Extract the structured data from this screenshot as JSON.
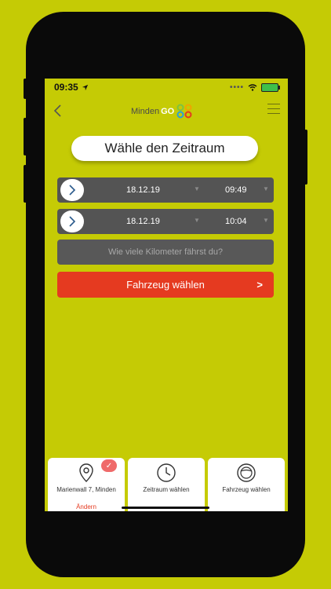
{
  "status": {
    "time": "09:35"
  },
  "header": {
    "logo_minden": "Minden",
    "logo_go": "GO"
  },
  "title": "Wähle den Zeitraum",
  "start": {
    "date": "18.12.19",
    "time": "09:49"
  },
  "end": {
    "date": "18.12.19",
    "time": "10:04"
  },
  "km_placeholder": "Wie viele Kilometer fährst du?",
  "cta_label": "Fahrzeug wählen",
  "steps": [
    {
      "label": "Marienwall 7, Minden",
      "action": "Ändern"
    },
    {
      "label": "Zeitraum wählen"
    },
    {
      "label": "Fahrzeug wählen"
    }
  ],
  "colors": {
    "background": "#c5cb05",
    "accent": "#e53a20",
    "row": "#545454"
  }
}
